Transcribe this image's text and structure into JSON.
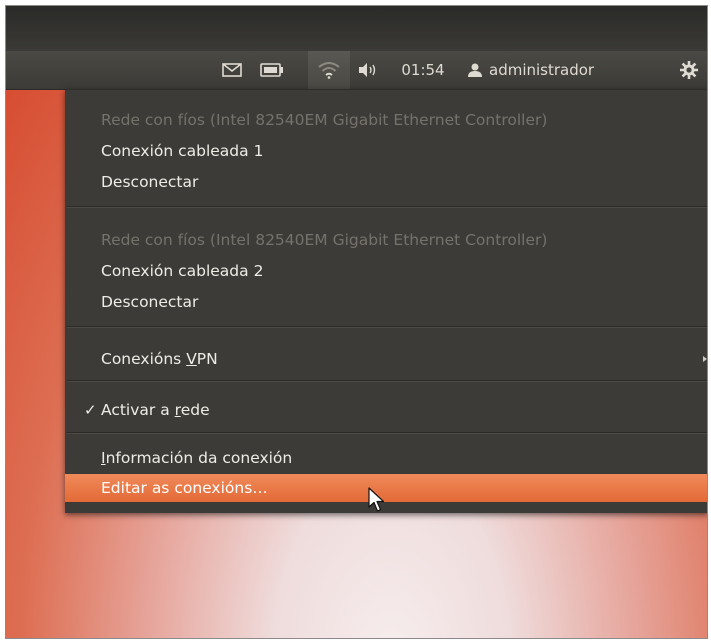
{
  "panel": {
    "icons": {
      "mail": "envelope-icon",
      "battery": "battery-icon",
      "network": "wifi-icon",
      "volume": "speaker-icon",
      "user": "person-icon",
      "session": "gear-icon"
    },
    "clock": "01:54",
    "username": "administrador"
  },
  "menu": {
    "device1_header": "Rede con fíos (Intel 82540EM Gigabit Ethernet Controller)",
    "device1_connection": "Conexión cableada 1",
    "device1_disconnect": "Desconectar",
    "device2_header": "Rede con fíos (Intel 82540EM Gigabit Ethernet Controller)",
    "device2_connection": "Conexión cableada 2",
    "device2_disconnect": "Desconectar",
    "vpn_prefix": "Conexións ",
    "vpn_mnemonic": "V",
    "vpn_suffix": "PN",
    "enable_check": "✓",
    "enable_prefix": "Activar a ",
    "enable_mnemonic": "r",
    "enable_suffix": "ede",
    "info_mnemonic": "I",
    "info_suffix": "nformación da conexión",
    "edit_label": "Editar as conexións…"
  },
  "colors": {
    "panel": "#3c3b37",
    "highlight": "#e9773f",
    "menu_text": "#efece6",
    "disabled_text": "#75726b",
    "wallpaper": "#d5452a"
  }
}
